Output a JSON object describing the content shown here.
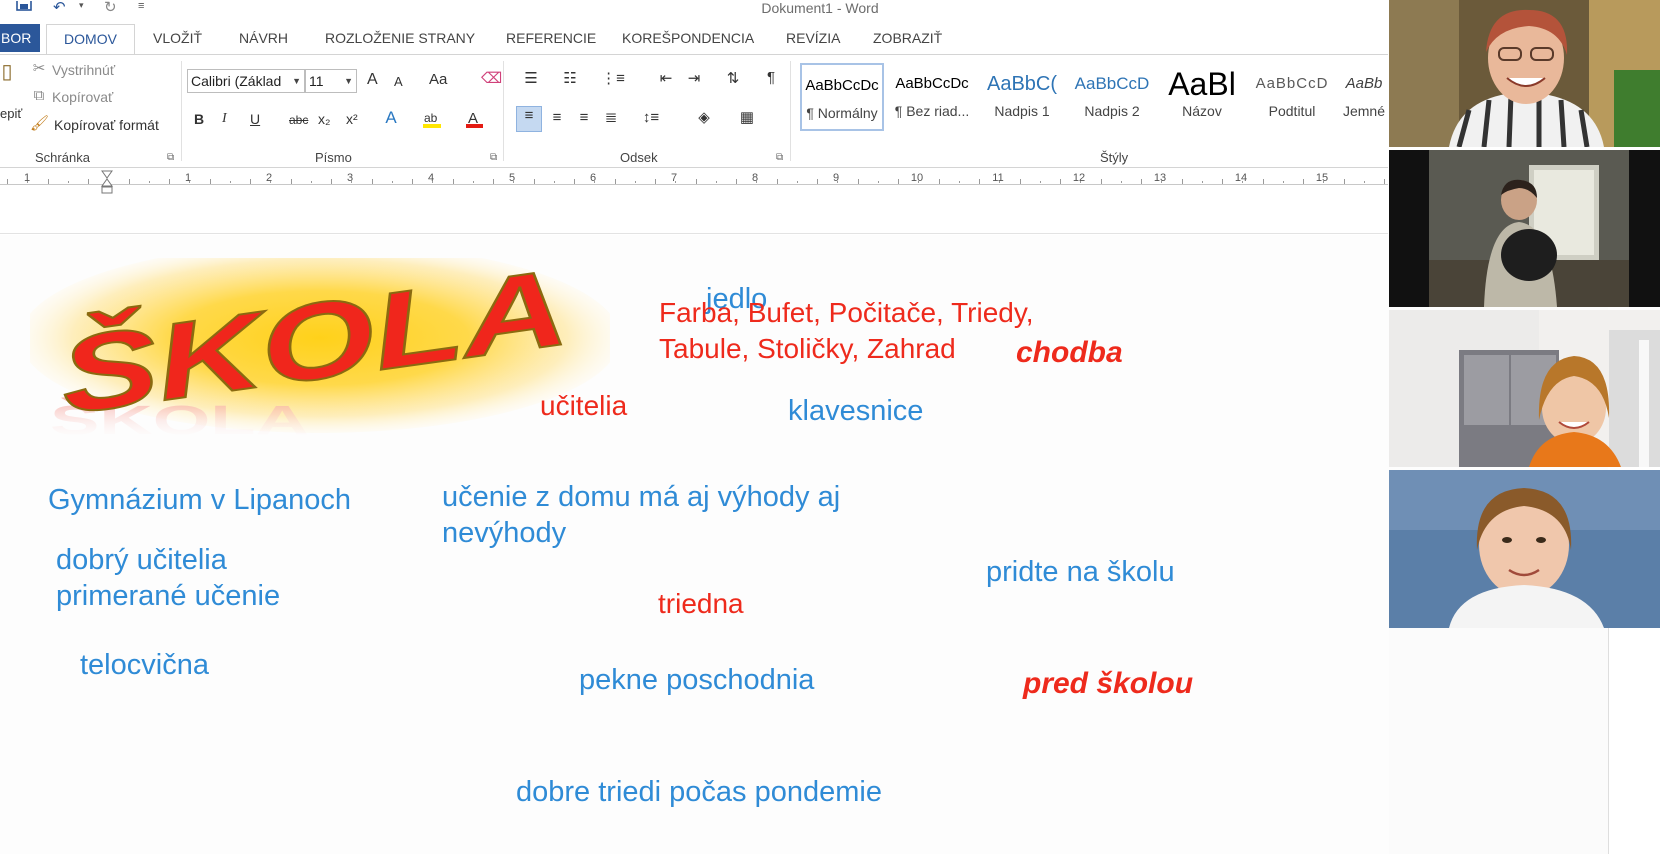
{
  "app": {
    "title": "Dokument1 - Word"
  },
  "tabs": [
    {
      "label": "BOR"
    },
    {
      "label": "DOMOV"
    },
    {
      "label": "VLOŽIŤ"
    },
    {
      "label": "NÁVRH"
    },
    {
      "label": "ROZLOŽENIE STRANY"
    },
    {
      "label": "REFERENCIE"
    },
    {
      "label": "KOREŠPONDENCIA"
    },
    {
      "label": "REVÍZIA"
    },
    {
      "label": "ZOBRAZIŤ"
    }
  ],
  "ribbon": {
    "clipboard": {
      "paste_label": "epiť",
      "cut_label": "Vystrihnúť",
      "copy_label": "Kopírovať",
      "format_painter_label": "Kopírovať formát",
      "group_label": "Schránka"
    },
    "font": {
      "font_name": "Calibri (Základ",
      "font_size": "11",
      "group_label": "Písmo",
      "bold": "B",
      "italic": "I",
      "underline": "U",
      "strike": "abc",
      "subscript": "x₂",
      "superscript": "x²",
      "grow": "A",
      "shrink": "A",
      "case": "Aa"
    },
    "paragraph": {
      "group_label": "Odsek"
    },
    "styles": {
      "group_label": "Štýly",
      "items": [
        {
          "sample": "AaBbCcDc",
          "name": "¶ Normálny"
        },
        {
          "sample": "AaBbCcDc",
          "name": "¶ Bez riad..."
        },
        {
          "sample": "AaBbC(",
          "name": "Nadpis 1"
        },
        {
          "sample": "AaBbCcD",
          "name": "Nadpis 2"
        },
        {
          "sample": "AaBl",
          "name": "Názov"
        },
        {
          "sample": "AaBbCcD",
          "name": "Podtitul"
        },
        {
          "sample": "AaBb",
          "name": "Jemné"
        }
      ]
    }
  },
  "ruler": {
    "numbers": [
      "1",
      "1",
      "2",
      "3",
      "4",
      "5",
      "6",
      "7",
      "8",
      "9",
      "10",
      "11",
      "12",
      "13",
      "14",
      "15"
    ]
  },
  "document": {
    "logo_text": "ŠKOLA",
    "words": {
      "jedlo": "jedlo",
      "farba_line1": "Farba, Bufet, Počitače, Triedy,",
      "farba_line2": "Tabule, Stoličky, Zahrad",
      "chodba": "chodba",
      "ucitelia": "učitelia",
      "klavesnice": "klavesnice",
      "gymnazium": "Gymnázium v Lipanoch",
      "ucenie_line1": "učenie z domu má aj výhody aj",
      "ucenie_line2": "nevýhody",
      "dobry_line1": "dobrý učitelia",
      "dobry_line2": "primerané učenie",
      "pridte": "pridte na školu",
      "triedna": "triedna",
      "telocvicna": "telocvična",
      "poschodnia": "pekne poschodnia",
      "pred_skolou": "pred školou",
      "dobre_triedi": "dobre triedi počas pondemie"
    }
  },
  "colors": {
    "word_accent": "#2b579a",
    "word_blue_text": "#2f8bd6",
    "word_red_text": "#ee2a1c"
  }
}
